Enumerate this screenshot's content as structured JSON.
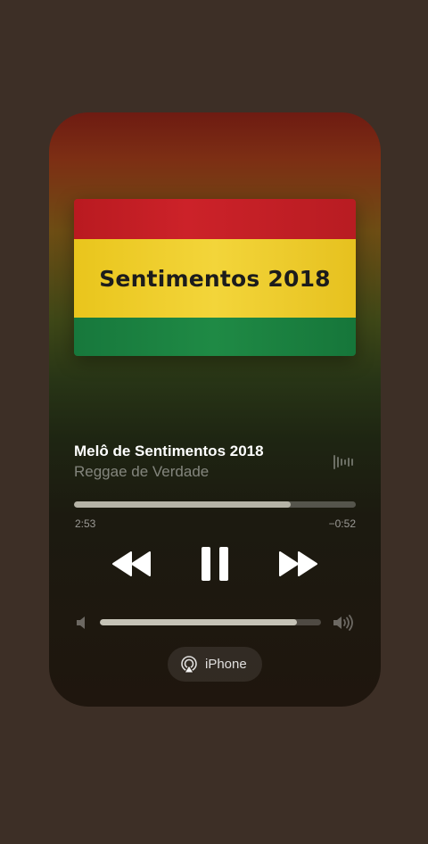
{
  "artwork": {
    "title": "Sentimentos 2018"
  },
  "track": {
    "title": "Melô de Sentimentos 2018",
    "artist": "Reggae de Verdade"
  },
  "progress": {
    "elapsed": "2:53",
    "remaining": "−0:52",
    "fraction": 0.77
  },
  "volume": {
    "fraction": 0.89
  },
  "output": {
    "device_label": "iPhone"
  },
  "icons": {
    "wave": "waveform-icon",
    "rewind": "rewind-icon",
    "pause": "pause-icon",
    "forward": "fast-forward-icon",
    "volume_low": "speaker-low-icon",
    "volume_high": "speaker-high-icon",
    "route": "airplay-icon"
  },
  "colors": {
    "background": "#3d2f26",
    "flag_red": "#cc2229",
    "flag_yellow": "#f3d53a",
    "flag_green": "#1f8a45"
  }
}
